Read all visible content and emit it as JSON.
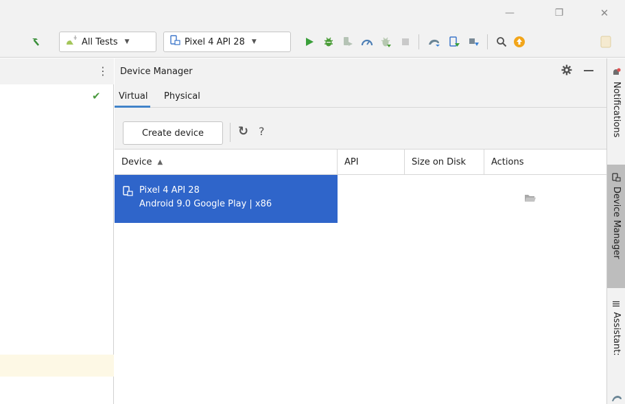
{
  "window": {
    "minimize_glyph": "—",
    "restore_glyph": "❐",
    "close_glyph": "✕"
  },
  "toolbar": {
    "run_config": {
      "label": "All Tests",
      "icon": "android-test-icon"
    },
    "device_selector": {
      "label": "Pixel 4 API 28",
      "icon": "phone-icon"
    },
    "icons": [
      "hammer-icon",
      "run-icon",
      "debug-icon",
      "attach-debugger-icon",
      "profile-icon",
      "apply-changes-icon",
      "stop-icon",
      "gradle-sync-icon",
      "device-manager-icon",
      "sdk-manager-icon",
      "search-icon",
      "update-icon",
      "account-icon"
    ],
    "colors": {
      "run": "#3a9f3a",
      "debug": "#4a9c37",
      "update": "#f2a51a"
    }
  },
  "left_panel": {
    "menu_glyph": "⋮",
    "check_glyph": "✔",
    "highlight_color": "#fdf8e5"
  },
  "device_manager": {
    "title": "Device Manager",
    "tabs": [
      {
        "label": "Virtual",
        "active": true
      },
      {
        "label": "Physical",
        "active": false
      }
    ],
    "create_button": "Create device",
    "refresh_glyph": "↻",
    "help_glyph": "?",
    "table": {
      "columns": [
        "Device",
        "API",
        "Size on Disk",
        "Actions"
      ],
      "sort_glyph": "▲",
      "rows": [
        {
          "name": "Pixel 4 API 28",
          "details": "Android 9.0 Google Play | x86",
          "api": "",
          "size": "",
          "selected": true
        }
      ]
    },
    "selected_color": "#2f65ca"
  },
  "right_strip": {
    "tabs": [
      {
        "label": "Notifications",
        "icon": "notifications-icon",
        "active": false
      },
      {
        "label": "Device Manager",
        "icon": "device-manager-icon",
        "active": true
      },
      {
        "label": "Assistant:",
        "icon": "assistant-icon",
        "active": false
      }
    ]
  }
}
